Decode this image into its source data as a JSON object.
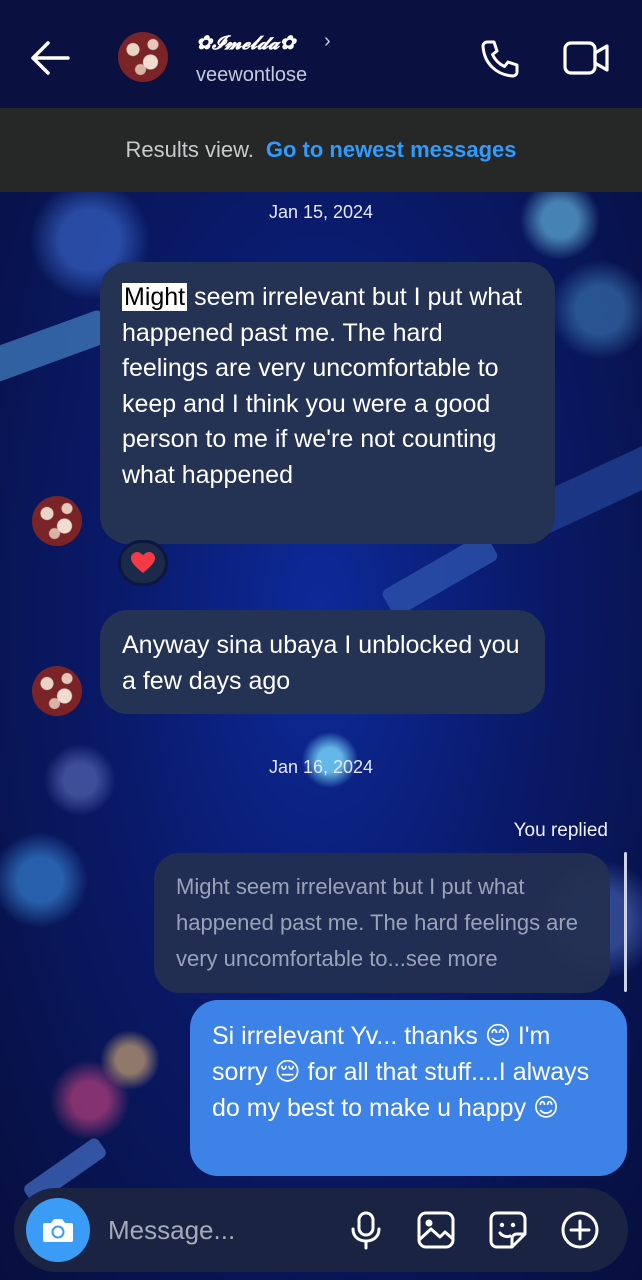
{
  "header": {
    "back_icon": "arrow-left-icon",
    "contact_name": "✿𝓘𝓶𝓮𝓵𝓭𝓪✿",
    "chevron": "›",
    "username": "veewontlose",
    "call_icon": "phone-icon",
    "video_icon": "video-camera-icon"
  },
  "results_banner": {
    "text": "Results view.",
    "link": "Go to newest messages"
  },
  "messages": {
    "date1": "Jan 15, 2024",
    "msg1_highlight": "Might",
    "msg1_rest": " seem irrelevant but I put what happened past me. The hard feelings are very uncomfortable to keep and I think you were a good person to me if we're not counting what happened",
    "reaction": "❤️",
    "msg2": "Anyway sina ubaya I unblocked you a few days ago",
    "date2": "Jan 16, 2024",
    "you_replied": "You replied",
    "quoted": "Might seem irrelevant but I put what happened past me. The hard feelings are very uncomfortable to...see more",
    "reply": "Si irrelevant Yv... thanks 😊 I'm sorry 😔 for all that stuff....I always do my best to make u happy 😊"
  },
  "composer": {
    "placeholder": "Message...",
    "camera_icon": "camera-icon",
    "mic_icon": "microphone-icon",
    "gallery_icon": "image-icon",
    "sticker_icon": "sticker-icon",
    "plus_icon": "plus-circle-icon"
  },
  "colors": {
    "header_bg": "#0a1040",
    "banner_bg": "#262727",
    "link": "#2f9bff",
    "incoming_bubble": "#243353",
    "outgoing_bubble": "#3d82e6",
    "camera_button": "#3a9cf5"
  }
}
